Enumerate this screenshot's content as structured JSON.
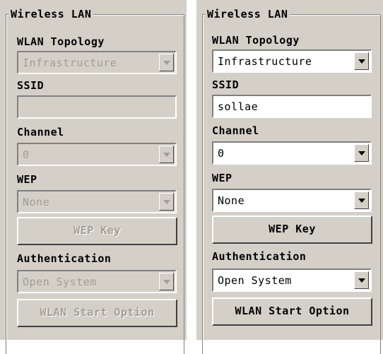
{
  "left_panel": {
    "group_title": "Wireless LAN",
    "topology_label": "WLAN Topology",
    "topology_value": "Infrastructure",
    "ssid_label": "SSID",
    "ssid_value": "",
    "channel_label": "Channel",
    "channel_value": "0",
    "wep_label": "WEP",
    "wep_value": "None",
    "wep_key_button": "WEP Key",
    "auth_label": "Authentication",
    "auth_value": "Open System",
    "start_option_button": "WLAN Start Option",
    "enabled": false
  },
  "right_panel": {
    "group_title": "Wireless LAN",
    "topology_label": "WLAN Topology",
    "topology_value": "Infrastructure",
    "ssid_label": "SSID",
    "ssid_value": "sollae",
    "channel_label": "Channel",
    "channel_value": "0",
    "wep_label": "WEP",
    "wep_value": "None",
    "wep_key_button": "WEP Key",
    "auth_label": "Authentication",
    "auth_value": "Open System",
    "start_option_button": "WLAN Start Option",
    "enabled": true
  },
  "colors": {
    "panel_bg": "#d4d0c8",
    "disabled_text": "#a19e96",
    "field_bg_enabled": "#ffffff"
  },
  "icons": {
    "dropdown": "chevron-down-icon"
  }
}
